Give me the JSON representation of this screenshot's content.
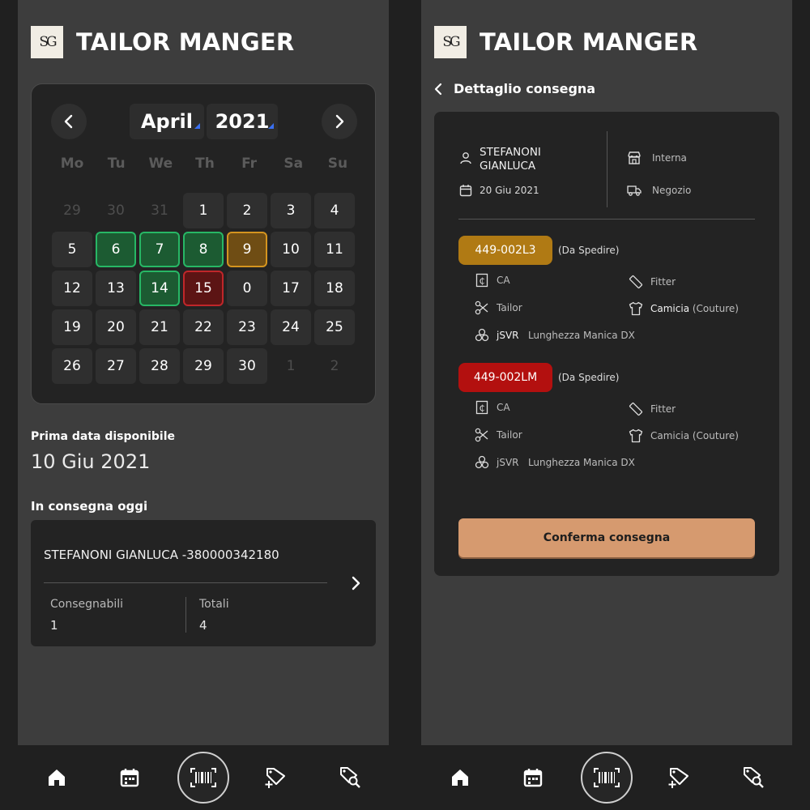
{
  "app": {
    "logo_text": "SG",
    "title": "TAILOR MANGER"
  },
  "calendar": {
    "month": "April",
    "year": "2021",
    "weekdays": [
      "Mo",
      "Tu",
      "We",
      "Th",
      "Fr",
      "Sa",
      "Su"
    ],
    "days": [
      {
        "label": "29",
        "state": "out"
      },
      {
        "label": "30",
        "state": "out"
      },
      {
        "label": "31",
        "state": "out"
      },
      {
        "label": "1",
        "state": "in"
      },
      {
        "label": "2",
        "state": "in"
      },
      {
        "label": "3",
        "state": "in"
      },
      {
        "label": "4",
        "state": "in"
      },
      {
        "label": "5",
        "state": "in"
      },
      {
        "label": "6",
        "state": "green"
      },
      {
        "label": "7",
        "state": "green"
      },
      {
        "label": "8",
        "state": "green"
      },
      {
        "label": "9",
        "state": "orange"
      },
      {
        "label": "10",
        "state": "in"
      },
      {
        "label": "11",
        "state": "in"
      },
      {
        "label": "12",
        "state": "in"
      },
      {
        "label": "13",
        "state": "in"
      },
      {
        "label": "14",
        "state": "green"
      },
      {
        "label": "15",
        "state": "red"
      },
      {
        "label": "0",
        "state": "in"
      },
      {
        "label": "17",
        "state": "in"
      },
      {
        "label": "18",
        "state": "in"
      },
      {
        "label": "19",
        "state": "in"
      },
      {
        "label": "20",
        "state": "in"
      },
      {
        "label": "21",
        "state": "in"
      },
      {
        "label": "22",
        "state": "in"
      },
      {
        "label": "23",
        "state": "in"
      },
      {
        "label": "24",
        "state": "in"
      },
      {
        "label": "25",
        "state": "in"
      },
      {
        "label": "26",
        "state": "in"
      },
      {
        "label": "27",
        "state": "in"
      },
      {
        "label": "28",
        "state": "in"
      },
      {
        "label": "29",
        "state": "in"
      },
      {
        "label": "30",
        "state": "in"
      },
      {
        "label": "1",
        "state": "out"
      },
      {
        "label": "2",
        "state": "out"
      }
    ],
    "state_colors": {
      "green": "#27b765",
      "orange": "#d4941f",
      "red": "#c0262a"
    }
  },
  "availability": {
    "label": "Prima data disponibile",
    "date": "10 Giu 2021"
  },
  "today": {
    "label": "In consegna oggi",
    "customer": "STEFANONI GIANLUCA -380000342180",
    "deliverable_label": "Consegnabili",
    "deliverable_value": "1",
    "total_label": "Totali",
    "total_value": "4"
  },
  "detail": {
    "back_label": "Dettaglio consegna",
    "customer_line1": "STEFANONI",
    "customer_line2": "GIANLUCA",
    "date": "20 Giu 2021",
    "type": "Interna",
    "channel": "Negozio",
    "items": [
      {
        "code": "449-002L3",
        "color": "#b07a14",
        "status": "(Da  Spedire)",
        "ca": "CA",
        "fitter": "Fitter",
        "tailor": "Tailor",
        "garment": "Camicia",
        "garment_note": "(Couture)",
        "fabric_code": "jSVR",
        "fabric_note": "Lunghezza Manica DX"
      },
      {
        "code": "449-002LM",
        "color": "#b3100f",
        "status": "(Da  Spedire)",
        "ca": "CA",
        "fitter": "Fitter",
        "tailor": "Tailor",
        "garment": "Camicia",
        "garment_note": "(Couture)",
        "fabric_code": "jSVR",
        "fabric_note": "Lunghezza Manica DX"
      }
    ],
    "confirm_label": "Conferma consegna"
  },
  "nav": {
    "items": [
      "home-icon",
      "calendar-icon",
      "barcode-scan-icon",
      "add-tag-icon",
      "search-tag-icon"
    ],
    "accent": "#d69a6f"
  }
}
